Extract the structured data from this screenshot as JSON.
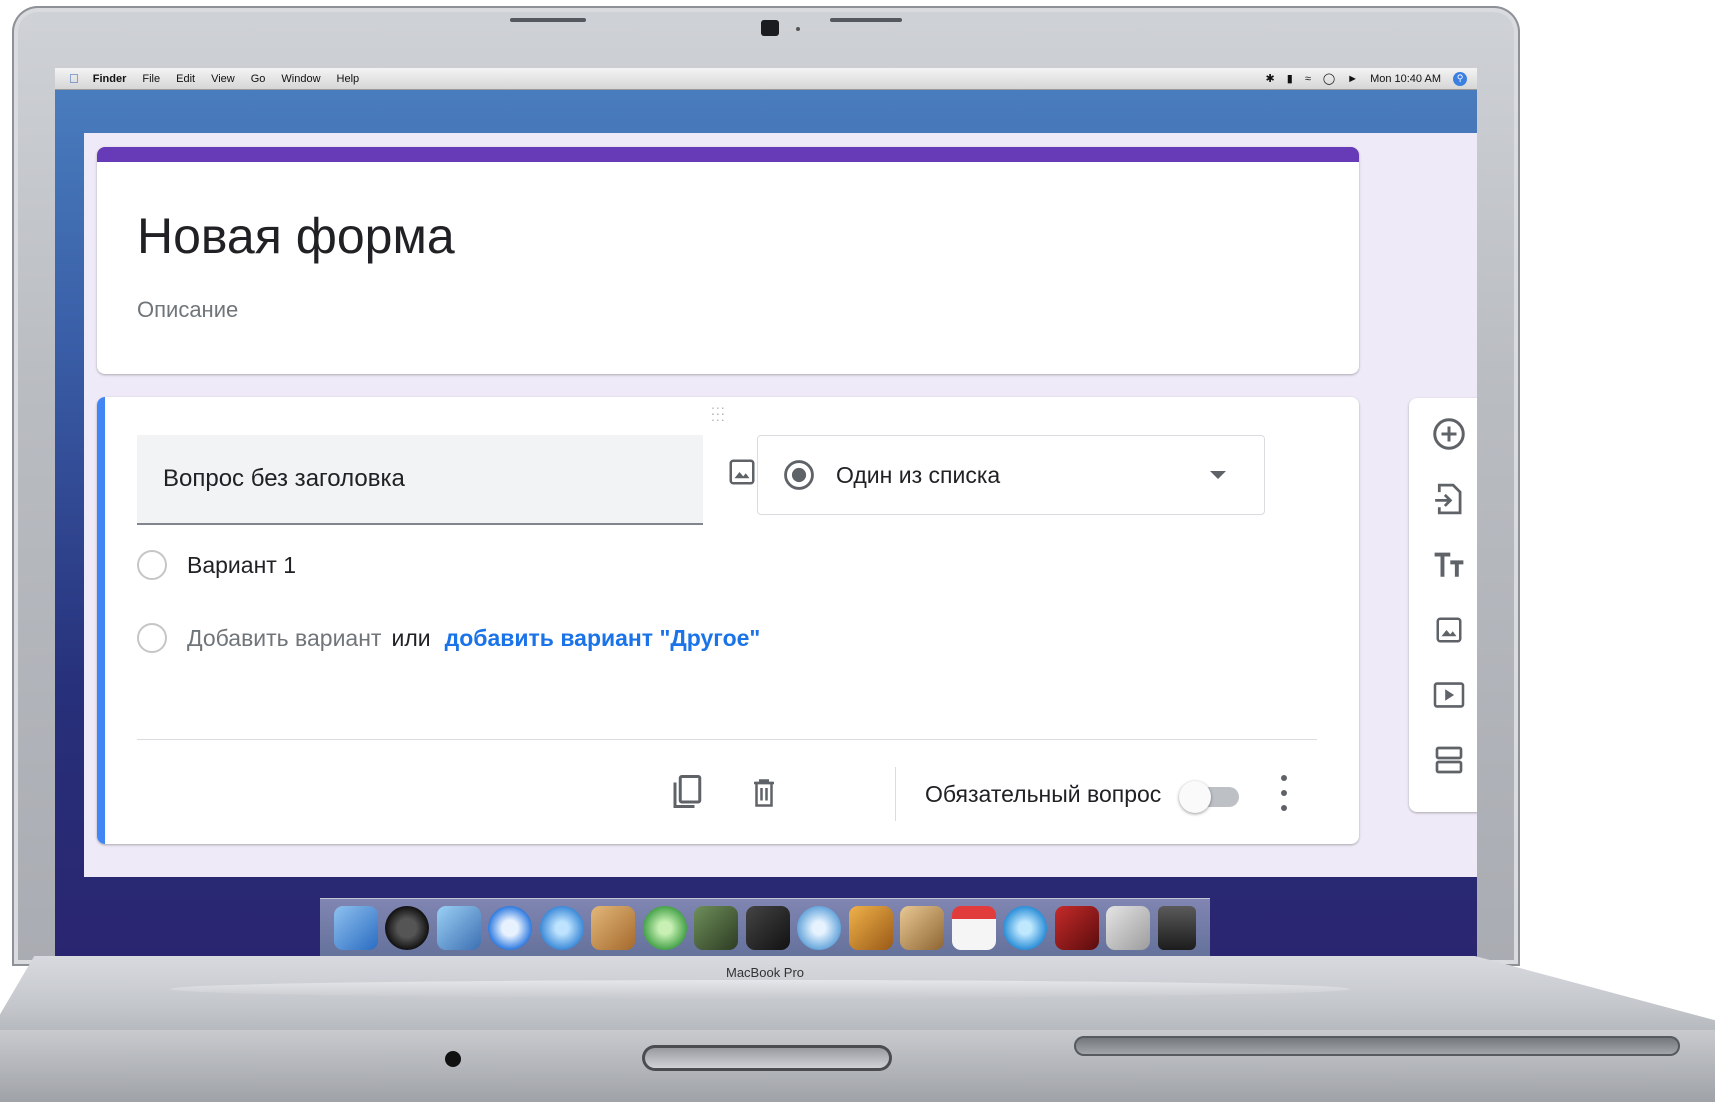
{
  "menubar": {
    "items": [
      "Finder",
      "File",
      "Edit",
      "View",
      "Go",
      "Window",
      "Help"
    ],
    "clock": "Mon 10:40 AM"
  },
  "form": {
    "title": "Новая форма",
    "description": "Описание",
    "accent_color": "#673ab7",
    "question": {
      "title": "Вопрос без заголовка",
      "type_label": "Один из списка",
      "options": [
        "Вариант 1"
      ],
      "add_option": "Добавить вариант",
      "or_text": "или",
      "add_other": "добавить вариант \"Другое\"",
      "required_label": "Обязательный вопрос",
      "required": false,
      "accent_color": "#4285f4"
    }
  },
  "side_toolbar": {
    "icons": [
      "add-question-icon",
      "import-questions-icon",
      "add-title-icon",
      "add-image-icon",
      "add-video-icon",
      "add-section-icon"
    ]
  },
  "laptop": {
    "brand": "MacBook Pro"
  }
}
